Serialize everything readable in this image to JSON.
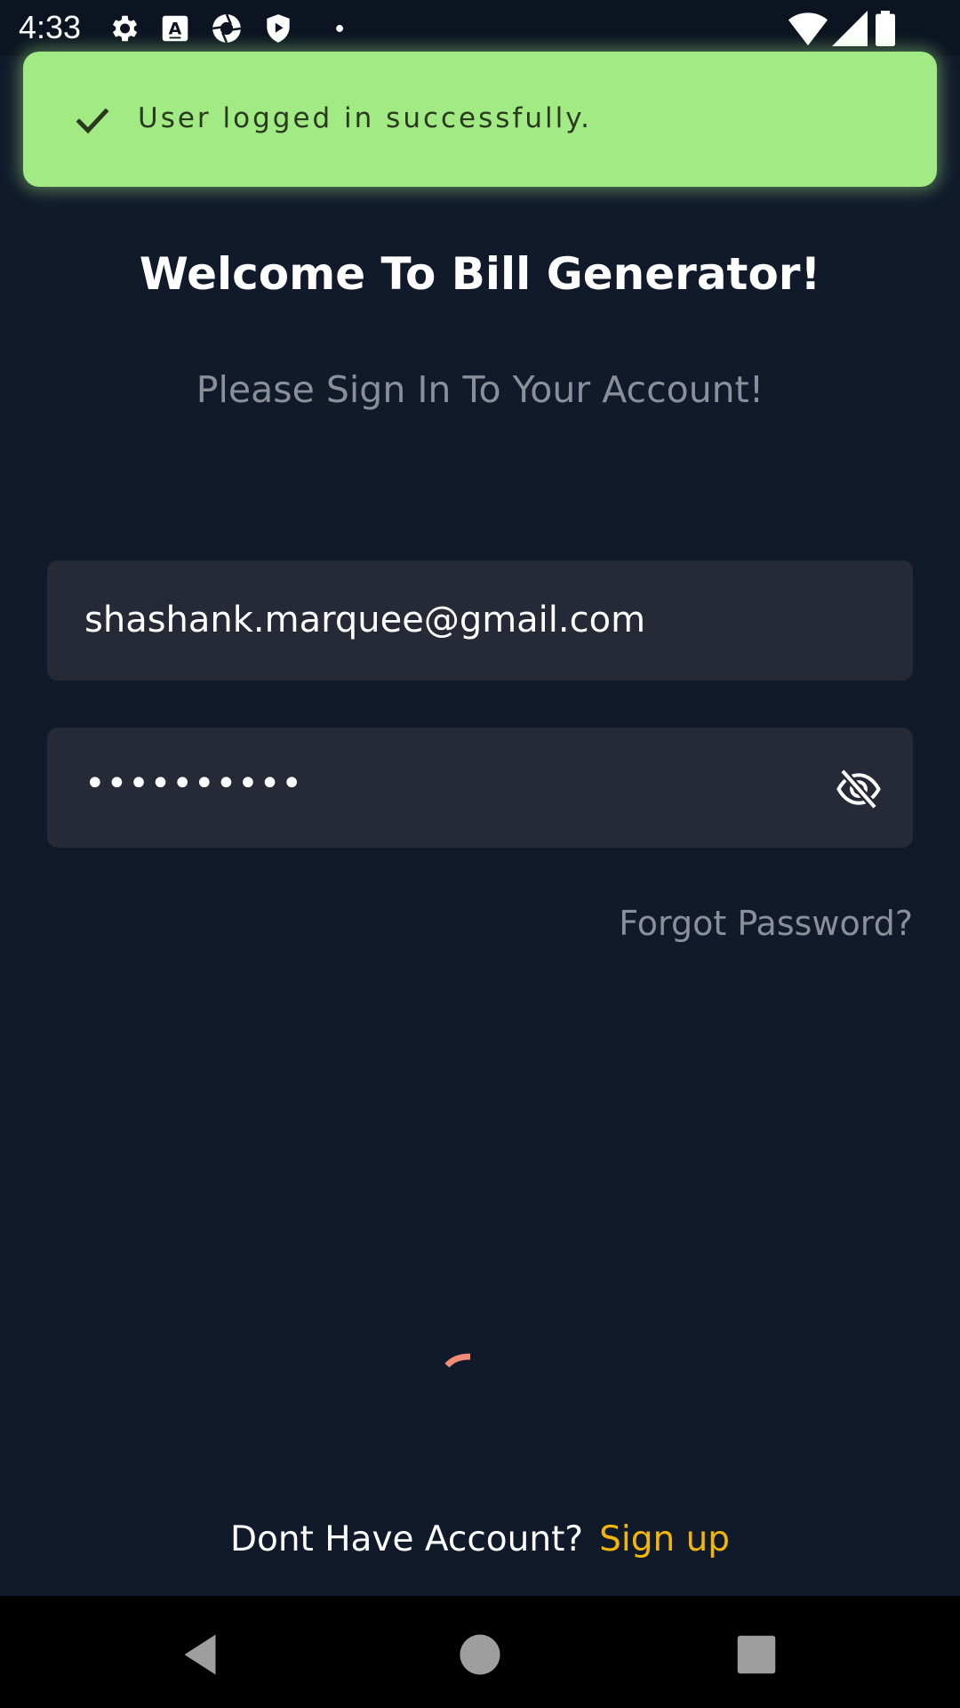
{
  "status_bar": {
    "time": "4:33",
    "left_icons": [
      "gear-icon",
      "font-a-icon",
      "camera-shutter-icon",
      "play-shield-icon",
      "dot-icon"
    ],
    "right_icons": [
      "wifi-icon",
      "cellular-signal-icon",
      "battery-icon"
    ]
  },
  "snackbar": {
    "icon": "check-icon",
    "message": "User logged in successfully.",
    "color": "#a1ea84"
  },
  "login": {
    "title": "Welcome To Bill Generator!",
    "subtitle": "Please Sign In To Your Account!",
    "email_value": "shashank.marquee@gmail.com",
    "password_value": "••••••••••",
    "password_toggle_icon": "eye-off-icon",
    "forgot_password": "Forgot Password?",
    "loading_indicator_color": "#f28b73",
    "signup_prompt": "Dont Have Account?",
    "signup_link": "Sign up",
    "accent_color": "#f2b705"
  },
  "nav_bar": {
    "buttons": [
      "back-icon",
      "home-icon",
      "recents-icon"
    ]
  }
}
